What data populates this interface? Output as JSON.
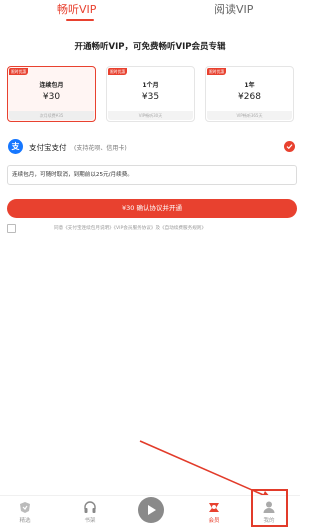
{
  "tabs": [
    {
      "label": "畅听VIP",
      "active": true
    },
    {
      "label": "阅读VIP",
      "active": false
    }
  ],
  "headline": "开通畅听VIP，可免费畅听VIP会员专辑",
  "plans": [
    {
      "badge": "限时优惠",
      "name": "连续包月",
      "price": "¥30",
      "note": "次月续费¥35",
      "selected": true
    },
    {
      "badge": "限时优惠",
      "name": "1个月",
      "price": "¥35",
      "note": "VIP畅听30天",
      "selected": false
    },
    {
      "badge": "限时优惠",
      "name": "1年",
      "price": "¥268",
      "note": "VIP畅听365天",
      "selected": false
    }
  ],
  "payment": {
    "icon": "alipay-icon",
    "icon_glyph": "支",
    "label": "支付宝支付",
    "sub": "(支持花呗、信用卡)",
    "selected": true
  },
  "notice": "连续包月，可随时取消，到期前以25元/月续费。",
  "cta_label": "¥30 确认协议并开通",
  "agreement": "同意《支付宝连续包月说明》《VIP会员服务协议》及《自动续费服务规则》",
  "nav": [
    {
      "label": "精选",
      "icon": "home-icon",
      "active": false
    },
    {
      "label": "书架",
      "icon": "headphones-icon",
      "active": false
    },
    {
      "label": "",
      "icon": "play-icon",
      "active": false
    },
    {
      "label": "会员",
      "icon": "vip-icon",
      "active": true
    },
    {
      "label": "我的",
      "icon": "profile-icon",
      "active": false
    }
  ],
  "colors": {
    "accent": "#e8412f",
    "alipay": "#1677ff",
    "annotation": "#e23b2a"
  }
}
